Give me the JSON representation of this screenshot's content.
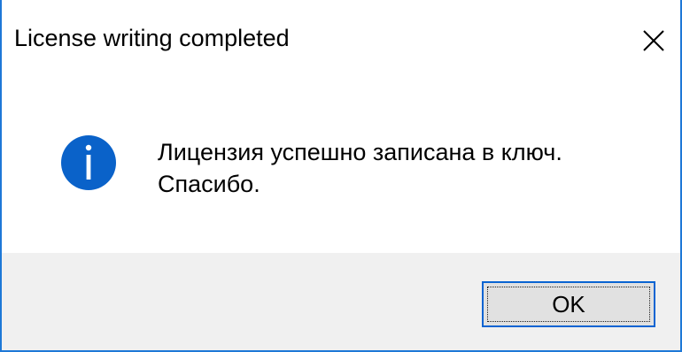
{
  "window": {
    "title": "License writing completed",
    "close_icon": "close-icon",
    "accent_color": "#1e78d7"
  },
  "message": {
    "icon": "info-icon",
    "icon_color": "#0a62c9",
    "line1": "Лицензия успешно записана в ключ.",
    "line2": "Спасибо."
  },
  "footer": {
    "ok_label": "OK",
    "background": "#f0f0f0"
  }
}
